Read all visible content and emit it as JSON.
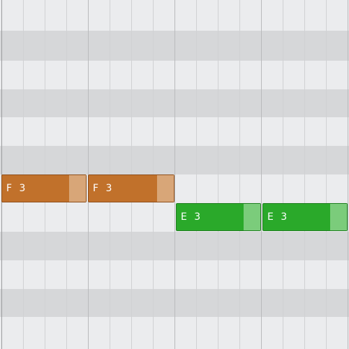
{
  "piano_roll": {
    "notes": [
      {
        "pitch_label": "F 3",
        "pitch": "F3",
        "start_step": 0,
        "length_steps": 4
      },
      {
        "pitch_label": "F 3",
        "pitch": "F3",
        "start_step": 4,
        "length_steps": 4
      },
      {
        "pitch_label": "E 3",
        "pitch": "E3",
        "start_step": 8,
        "length_steps": 4
      },
      {
        "pitch_label": "E 3",
        "pitch": "E3",
        "start_step": 12,
        "length_steps": 4
      }
    ],
    "colors": {
      "f3_note": "#c1712b",
      "e3_note": "#2aa92a",
      "white_key_lane": "#ebecee",
      "black_key_lane": "#d6d7d9"
    }
  }
}
